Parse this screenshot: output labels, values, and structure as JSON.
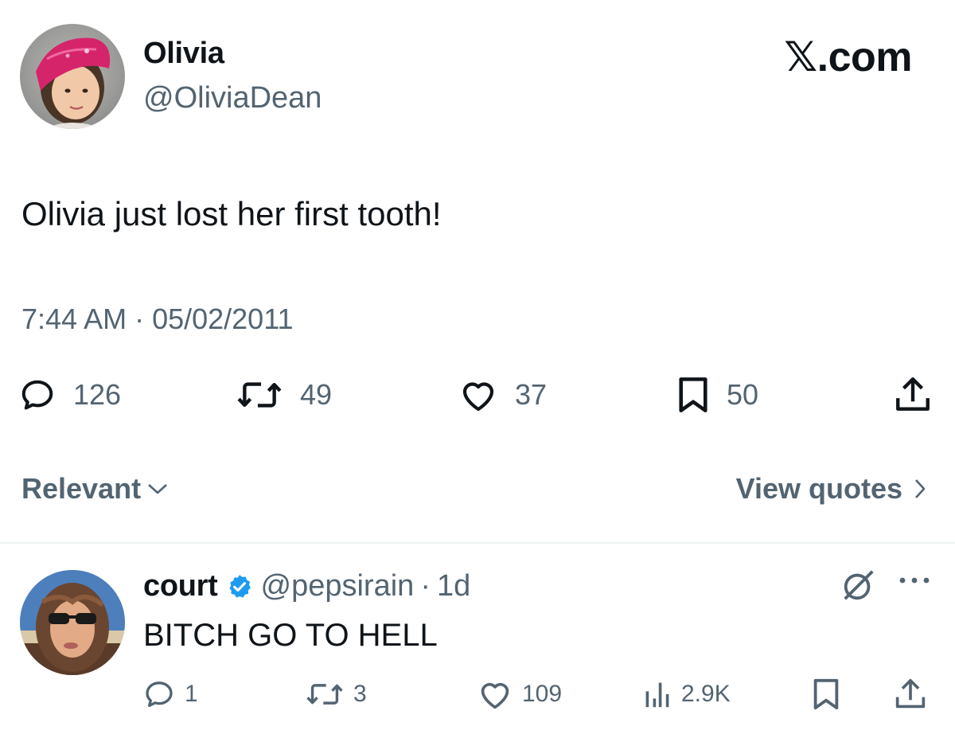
{
  "brand": {
    "logo_text": "𝕏",
    "logo_suffix": ".com"
  },
  "main_tweet": {
    "author": {
      "display_name": "Olivia",
      "handle": "@OliviaDean",
      "avatar": "avatar-child-pink-bandana"
    },
    "text": "Olivia just lost her first tooth!",
    "timestamp": "7:44 AM · 05/02/2011",
    "actions": {
      "replies": "126",
      "reposts": "49",
      "likes": "37",
      "bookmarks": "50"
    }
  },
  "sort_bar": {
    "sort_label": "Relevant",
    "view_quotes_label": "View quotes"
  },
  "reply": {
    "author": {
      "display_name": "court",
      "handle": "@pepsirain",
      "verified": true,
      "avatar": "avatar-woman-sunglasses"
    },
    "separator": "·",
    "age": "1d",
    "text": "BITCH GO TO HELL",
    "actions": {
      "replies": "1",
      "reposts": "3",
      "likes": "109",
      "views": "2.9K"
    }
  },
  "colors": {
    "text_primary": "#0f1419",
    "text_secondary": "#536471",
    "verified_blue": "#1d9bf0",
    "divider": "#eff3f4"
  }
}
